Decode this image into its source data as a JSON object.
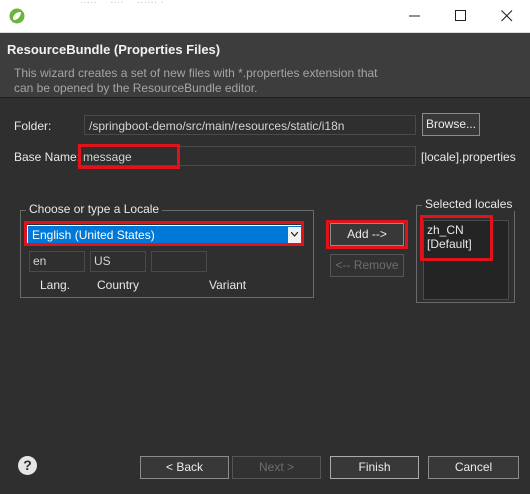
{
  "window": {
    "title_peek": "~ ..... ~ .... ~ ...... . ~",
    "icons": {
      "app": "spring-leaf-icon",
      "minimize": "minimize-icon",
      "maximize": "maximize-icon",
      "close": "close-icon"
    }
  },
  "header": {
    "title": "ResourceBundle (Properties Files)",
    "description": "This wizard creates a set of new files with *.properties extension that can be opened by the ResourceBundle editor."
  },
  "form": {
    "folder_label": "Folder:",
    "folder_value": "/springboot-demo/src/main/resources/static/i18n",
    "browse_label": "Browse...",
    "base_name_label": "Base Name:",
    "base_name_value": "message",
    "suffix": "[locale].properties"
  },
  "locale_group": {
    "legend": "Choose or type a Locale",
    "selected": "English (United States)",
    "lang_value": "en",
    "country_value": "US",
    "variant_value": "",
    "lang_label": "Lang.",
    "country_label": "Country",
    "variant_label": "Variant"
  },
  "actions": {
    "add_label": "Add   -->",
    "remove_label": "<-- Remove"
  },
  "selected_group": {
    "legend": "Selected locales",
    "items": [
      "zh_CN",
      "[Default]"
    ]
  },
  "footer": {
    "back_label": "< Back",
    "next_label": "Next >",
    "finish_label": "Finish",
    "cancel_label": "Cancel",
    "help_icon": "help-icon"
  },
  "colors": {
    "highlight": "#e0131a",
    "selection": "#0078d7",
    "background": "#2f2f2f"
  }
}
